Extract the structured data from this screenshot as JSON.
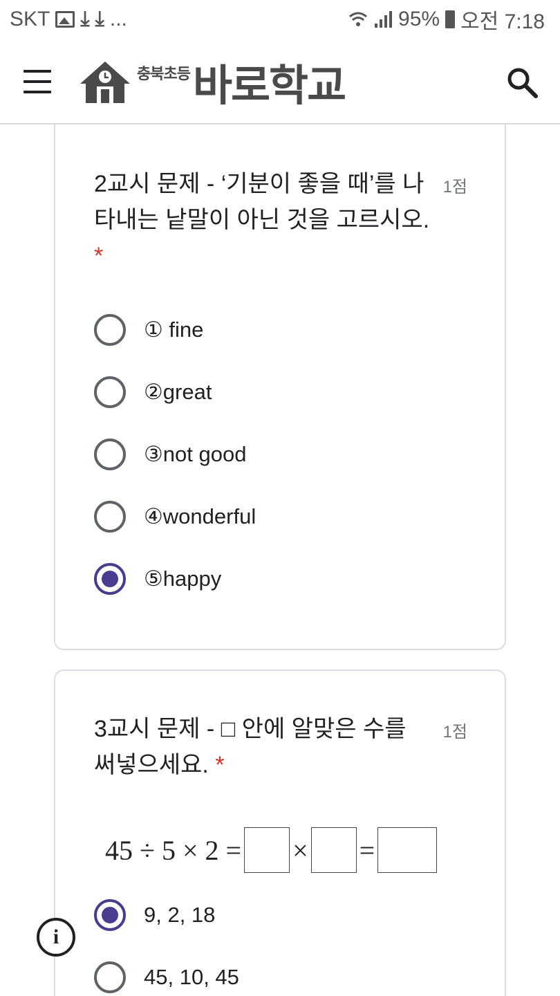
{
  "status_bar": {
    "carrier": "SKT",
    "notifications": [
      "image-icon",
      "download-icon",
      "download-icon"
    ],
    "more": "...",
    "battery": "95%",
    "time": "오전 7:18"
  },
  "app_bar": {
    "logo_small": "충북초등",
    "logo_big": "바로학교"
  },
  "questions": [
    {
      "title": "2교시 문제 - ‘기분이 좋을 때’를 나타내는 낱말이 아닌 것을 고르시오.",
      "required_mark": "*",
      "points": "1점",
      "options": [
        {
          "label": "① fine",
          "checked": false
        },
        {
          "label": "②great",
          "checked": false
        },
        {
          "label": "③not good",
          "checked": false
        },
        {
          "label": "④wonderful",
          "checked": false
        },
        {
          "label": "⑤happy",
          "checked": true
        }
      ]
    },
    {
      "title": "3교시 문제 - □ 안에 알맞은 수를 써넣으세요.",
      "required_mark": "*",
      "points": "1점",
      "equation": {
        "lhs": "45 ÷ 5 × 2 =",
        "times": "×",
        "equals": "="
      },
      "options": [
        {
          "label": "9, 2, 18",
          "checked": true
        },
        {
          "label": "45, 10, 45",
          "checked": false
        }
      ]
    }
  ],
  "colors": {
    "accent": "#4a3d8f",
    "required": "#d93025",
    "border": "#dadce0"
  }
}
